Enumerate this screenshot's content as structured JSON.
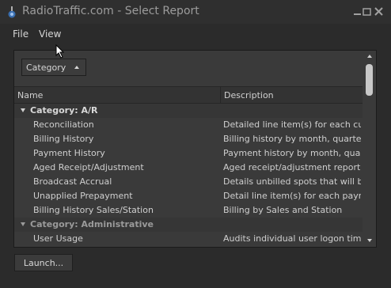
{
  "window": {
    "title": "RadioTraffic.com - Select Report",
    "app_icon": "radio-app-icon",
    "controls": [
      "minimize-icon",
      "restore-icon",
      "close-icon"
    ]
  },
  "menu": [
    "File",
    "View"
  ],
  "category_button": {
    "label": "Category",
    "icon": "sort-up-arrow-icon"
  },
  "table": {
    "columns": [
      "Name",
      "Description"
    ],
    "groups": [
      {
        "label": "Category: A/R",
        "items": [
          {
            "name": "Reconciliation",
            "description": "Detailed line item(s) for each cus..."
          },
          {
            "name": "Billing History",
            "description": "Billing history by month, quarter ..."
          },
          {
            "name": "Payment History",
            "description": "Payment history by month, quart..."
          },
          {
            "name": "Aged Receipt/Adjustment",
            "description": "Aged receipt/adjustment report."
          },
          {
            "name": "Broadcast Accrual",
            "description": "Details unbilled spots that will be ..."
          },
          {
            "name": "Unapplied Prepayment",
            "description": "Detail line item(s) for each paym..."
          },
          {
            "name": "Billing History Sales/Station",
            "description": "Billing by Sales and Station"
          }
        ]
      },
      {
        "label": "Category: Administrative",
        "items": [
          {
            "name": "User Usage",
            "description": "Audits individual user logon times..."
          }
        ]
      }
    ]
  },
  "launch_button": "Launch..."
}
